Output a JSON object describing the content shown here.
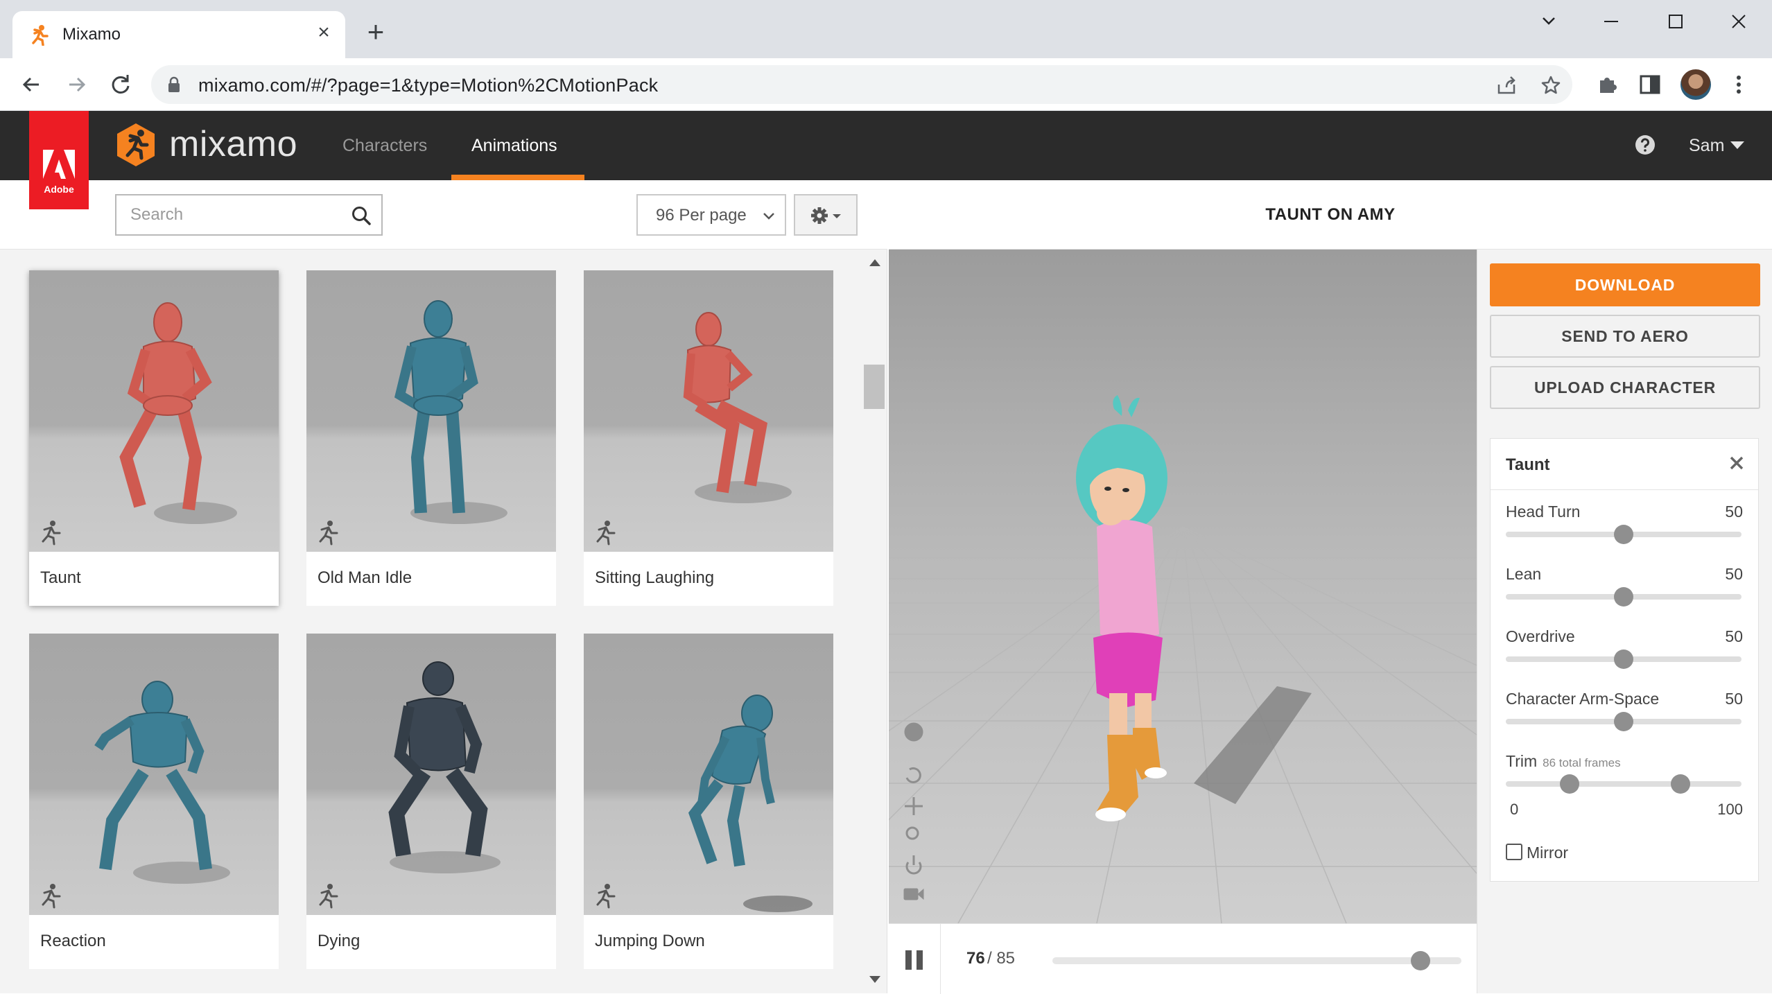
{
  "browser": {
    "tab_title": "Mixamo",
    "url": "mixamo.com/#/?page=1&type=Motion%2CMotionPack"
  },
  "header": {
    "logo_text": "mixamo",
    "adobe_label": "Adobe",
    "tabs": [
      {
        "label": "Characters",
        "active": false
      },
      {
        "label": "Animations",
        "active": true
      }
    ],
    "user": "Sam"
  },
  "filters": {
    "search_placeholder": "Search",
    "per_page": "96 Per page"
  },
  "animations": [
    {
      "name": "Taunt",
      "selected": true,
      "color": "#d4645a"
    },
    {
      "name": "Old Man Idle",
      "selected": false,
      "color": "#3d7f95"
    },
    {
      "name": "Sitting Laughing",
      "selected": false,
      "color": "#d4645a"
    },
    {
      "name": "Reaction",
      "selected": false,
      "color": "#3d7f95"
    },
    {
      "name": "Dying",
      "selected": false,
      "color": "#3b4652"
    },
    {
      "name": "Jumping Down",
      "selected": false,
      "color": "#3d7f95"
    }
  ],
  "viewer": {
    "title": "TAUNT ON AMY",
    "frame_current": "76",
    "frame_total": "/ 85",
    "playhead_fraction": 0.9
  },
  "actions": {
    "download": "DOWNLOAD",
    "send_to_aero": "SEND TO AERO",
    "upload_character": "UPLOAD CHARACTER"
  },
  "settings": {
    "title": "Taunt",
    "params": [
      {
        "label": "Head Turn",
        "value": "50",
        "fraction": 0.5
      },
      {
        "label": "Lean",
        "value": "50",
        "fraction": 0.5
      },
      {
        "label": "Overdrive",
        "value": "50",
        "fraction": 0.5
      },
      {
        "label": "Character Arm-Space",
        "value": "50",
        "fraction": 0.5
      }
    ],
    "trim": {
      "label": "Trim",
      "sublabel": "86 total frames",
      "min": "0",
      "max": "100",
      "start_fraction": 0.27,
      "end_fraction": 0.74
    },
    "mirror_label": "Mirror",
    "mirror_checked": false
  },
  "colors": {
    "accent": "#f58220",
    "adobe_red": "#ec1c24",
    "header_bg": "#2b2b2b"
  }
}
